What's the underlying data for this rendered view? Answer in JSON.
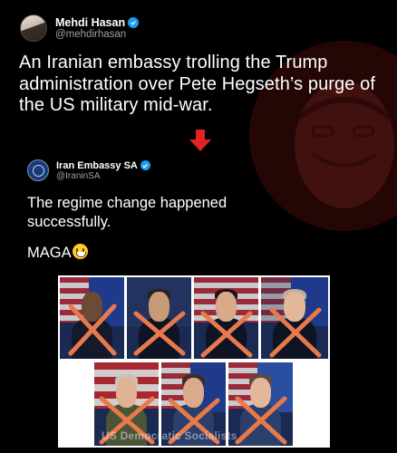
{
  "post": {
    "author_name": "Mehdi Hasan",
    "author_handle": "@mehdirhasan",
    "text": "An Iranian embassy trolling the Trump administration over Pete Hegseth’s purge of the US military mid-war."
  },
  "quoted": {
    "author_name": "Iran Embassy SA",
    "author_handle": "@IraninSA",
    "line1": "The regime change happened successfully.",
    "line2": "MAGA"
  },
  "image": {
    "watermark": "US Democratic Socialists",
    "top_row_count": 4,
    "bottom_row_count": 3
  },
  "colors": {
    "verified": "#1d9bf0",
    "arrow": "#e02424",
    "cross": "#e8794a"
  },
  "icons": {
    "verified": "verified-badge-icon",
    "arrow": "down-arrow-icon",
    "smiley": "grinning-face-emoji"
  }
}
